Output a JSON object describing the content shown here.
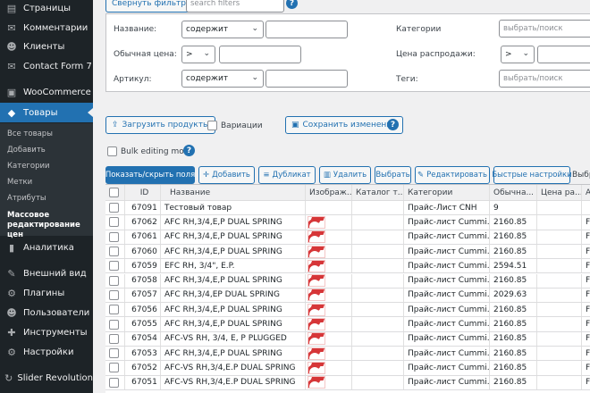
{
  "sidebar": {
    "items_top": [
      {
        "label": "Страницы",
        "icon": "page-icon",
        "glyph": "▤"
      },
      {
        "label": "Комментарии",
        "icon": "comments-icon",
        "glyph": "✉"
      },
      {
        "label": "Клиенты",
        "icon": "users-icon",
        "glyph": "☻"
      },
      {
        "label": "Contact Form 7",
        "icon": "mail-icon",
        "glyph": "✉"
      },
      {
        "label": "WooCommerce",
        "icon": "woocommerce-icon",
        "glyph": "▣"
      },
      {
        "label": "Товары",
        "icon": "products-icon",
        "glyph": "◆"
      }
    ],
    "submenu": [
      {
        "label": "Все товары"
      },
      {
        "label": "Добавить"
      },
      {
        "label": "Категории"
      },
      {
        "label": "Метки"
      },
      {
        "label": "Атрибуты"
      },
      {
        "label": "Массовое редактирование цен"
      }
    ],
    "items_bottom": [
      {
        "label": "Аналитика",
        "icon": "analytics-icon",
        "glyph": "▮"
      },
      {
        "label": "Внешний вид",
        "icon": "appearance-icon",
        "glyph": "✎"
      },
      {
        "label": "Плагины",
        "icon": "plugins-icon",
        "glyph": "⚙"
      },
      {
        "label": "Пользователи",
        "icon": "user-icon",
        "glyph": "☻"
      },
      {
        "label": "Инструменты",
        "icon": "tools-icon",
        "glyph": "✚"
      },
      {
        "label": "Настройки",
        "icon": "settings-icon",
        "glyph": "⚙"
      },
      {
        "label": "Slider Revolution",
        "icon": "slider-icon",
        "glyph": "↻"
      }
    ]
  },
  "filters": {
    "collapse_label": "Свернуть фильтры",
    "search_placeholder": "search filters",
    "name_label": "Название:",
    "name_op": "содержит",
    "price_label": "Обычная цена:",
    "price_op": ">",
    "sku_label": "Артикул:",
    "sku_op": "содержит",
    "categories_label": "Категории",
    "categories_placeholder": "выбрать/поиск",
    "sale_label": "Цена распродажи:",
    "sale_op": ">",
    "tags_label": "Теги:",
    "tags_placeholder": "выбрать/поиск"
  },
  "actions": {
    "load_products": "Загрузить продукты",
    "variations": "Вариации",
    "save_changes": "Сохранить изменение",
    "bulk_mode": "Bulk editing mode"
  },
  "toolbar": {
    "show_hide": "Показать/скрыть поля",
    "add": "Добавить",
    "duplicate": "Дубликат",
    "delete": "Удалить",
    "select": "Выбрать",
    "edit": "Редактировать",
    "quick_settings": "Быстрые настройки",
    "overflow": "Выбр"
  },
  "grid": {
    "headers": [
      "ID",
      "Название",
      "Изображ...",
      "Каталог т...",
      "Категории",
      "Обычна...",
      "Цена ра...",
      "А"
    ],
    "rows": [
      {
        "id": "67091",
        "name": "Тестовый товар",
        "image": false,
        "category": "Прайс-Лист CNH",
        "price": "9",
        "extra": ""
      },
      {
        "id": "67062",
        "name": "AFC RH,3/4,E,P DUAL SPRING",
        "image": true,
        "category": "Прайс-лист Cummi...",
        "price": "2160.85",
        "extra": "F"
      },
      {
        "id": "67061",
        "name": "AFC RH,3/4,E,P DUAL SPRING",
        "image": true,
        "category": "Прайс-лист Cummi...",
        "price": "2160.85",
        "extra": "F"
      },
      {
        "id": "67060",
        "name": "AFC RH,3/4,E,P DUAL SPRING",
        "image": true,
        "category": "Прайс-лист Cummi...",
        "price": "2160.85",
        "extra": "F"
      },
      {
        "id": "67059",
        "name": "EFC RH, 3/4\", E.P.",
        "image": true,
        "category": "Прайс-лист Cummi...",
        "price": "2594.51",
        "extra": "F"
      },
      {
        "id": "67058",
        "name": "AFC RH,3/4,E,P DUAL SPRING",
        "image": true,
        "category": "Прайс-лист Cummi...",
        "price": "2160.85",
        "extra": "F"
      },
      {
        "id": "67057",
        "name": "AFC RH,3/4,EP DUAL SPRING",
        "image": true,
        "category": "Прайс-лист Cummi...",
        "price": "2029.63",
        "extra": "F"
      },
      {
        "id": "67056",
        "name": "AFC RH,3/4,E,P DUAL SPRING",
        "image": true,
        "category": "Прайс-лист Cummi...",
        "price": "2160.85",
        "extra": "F"
      },
      {
        "id": "67055",
        "name": "AFC RH,3/4,E,P DUAL SPRING",
        "image": true,
        "category": "Прайс-лист Cummi...",
        "price": "2160.85",
        "extra": "F"
      },
      {
        "id": "67054",
        "name": "AFC-VS RH, 3/4, E, P PLUGGED",
        "image": true,
        "category": "Прайс-лист Cummi...",
        "price": "2160.85",
        "extra": "F"
      },
      {
        "id": "67053",
        "name": "AFC RH,3/4,E,P DUAL SPRING",
        "image": true,
        "category": "Прайс-лист Cummi...",
        "price": "2160.85",
        "extra": "F"
      },
      {
        "id": "67052",
        "name": "AFC-VS RH,3/4,E.P DUAL SPRING",
        "image": true,
        "category": "Прайс-лист Cummi...",
        "price": "2160.85",
        "extra": "F"
      },
      {
        "id": "67051",
        "name": "AFC-VS RH,3/4,E.P DUAL SPRING",
        "image": true,
        "category": "Прайс-лист Cummi...",
        "price": "2160.85",
        "extra": "F"
      }
    ]
  }
}
